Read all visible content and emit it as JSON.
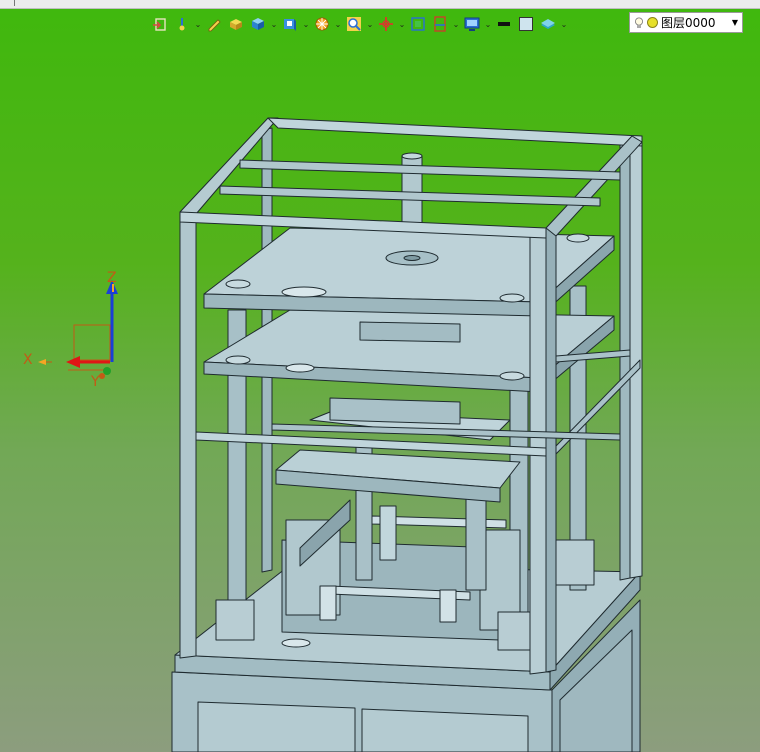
{
  "toolbar": {
    "icons": [
      "exit-view-icon",
      "spin-icon",
      "sketch-pen-icon",
      "solid-block-icon",
      "cube-icon",
      "view-cube-icon",
      "render-mode-icon",
      "zoom-icon",
      "move-origin-icon",
      "fit-view-icon",
      "section-icon",
      "display-monitor-icon",
      "line-weight-icon",
      "color-swatch-icon",
      "layer-icon"
    ]
  },
  "layer": {
    "name": "图层0000"
  },
  "axes": {
    "x": "X",
    "y": "Y",
    "z": "Z"
  },
  "colors": {
    "bg_top": "#3fb80d",
    "bg_bottom": "#8c9d7e",
    "model": "#a9c2c8",
    "edge": "#1f2b30",
    "axis_x": "#e01616",
    "axis_z": "#1a3fd6",
    "axis_y": "#22a02a"
  }
}
